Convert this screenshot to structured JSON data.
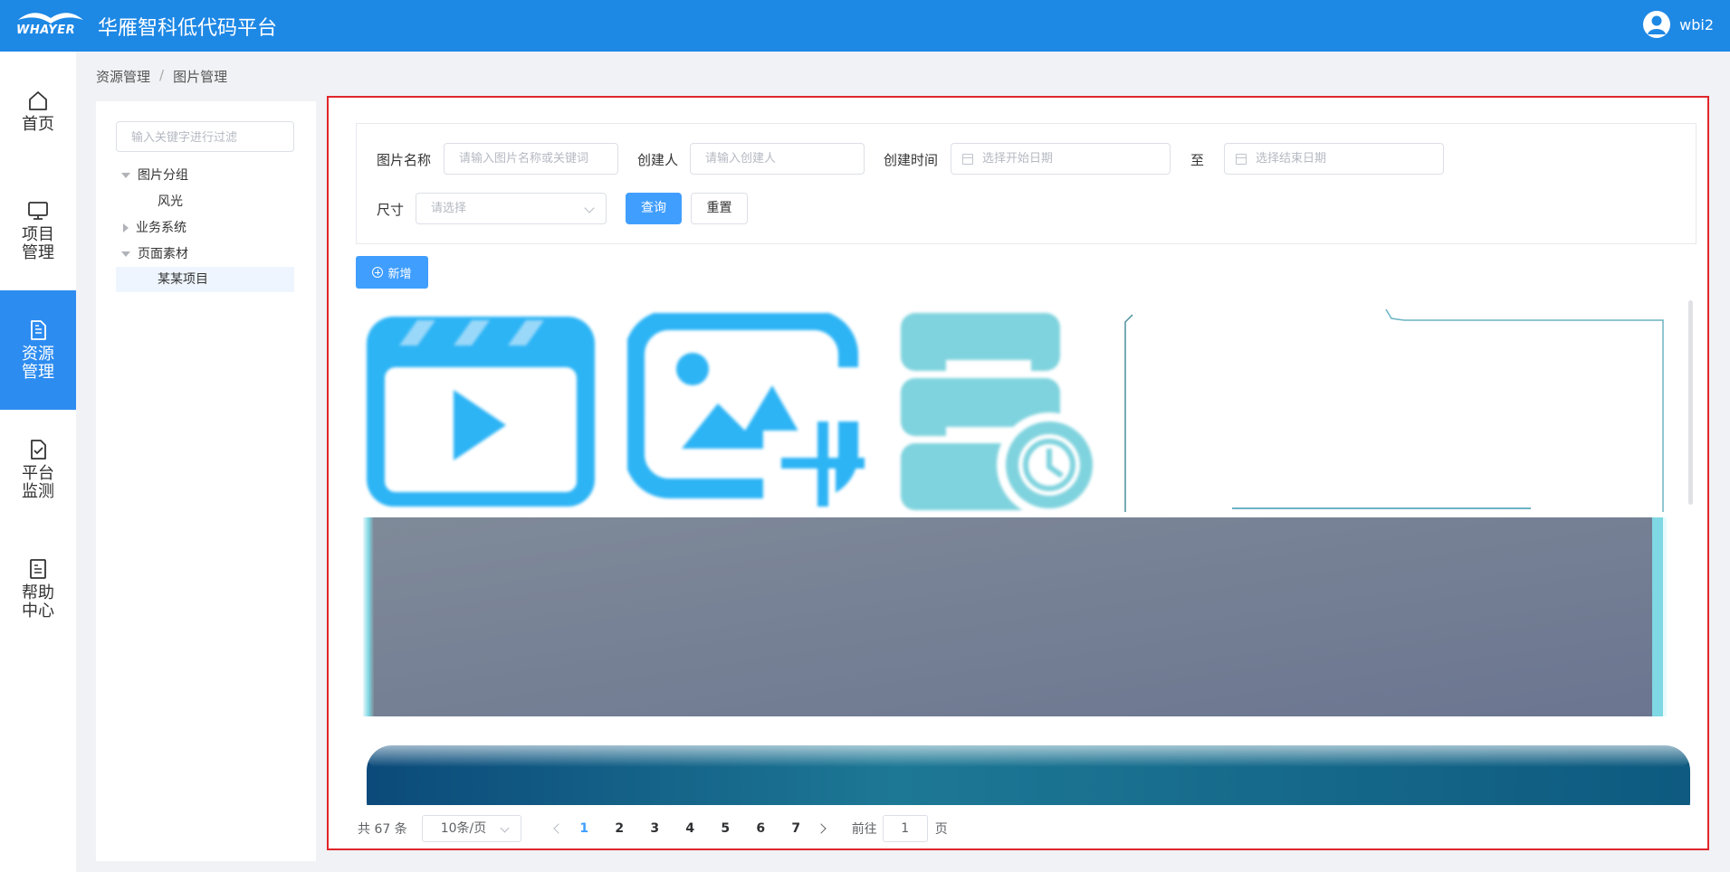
{
  "header": {
    "logo_text": "WHAYER",
    "title": "华雁智科低代码平台",
    "user_name": "wbi2"
  },
  "sidebar": {
    "items": [
      {
        "label": "首页",
        "icon": "home-icon",
        "active": false
      },
      {
        "label": "项目管理",
        "icon": "monitor-icon",
        "active": false
      },
      {
        "label": "资源管理",
        "icon": "document-icon",
        "active": true
      },
      {
        "label": "平台监测",
        "icon": "check-document-icon",
        "active": false
      },
      {
        "label": "帮助中心",
        "icon": "list-document-icon",
        "active": false
      }
    ]
  },
  "breadcrumb": {
    "items": [
      "资源管理",
      "图片管理"
    ],
    "separator": "/"
  },
  "tree": {
    "search_placeholder": "输入关键字进行过滤",
    "nodes": [
      {
        "label": "图片分组",
        "level": 1,
        "expanded": true
      },
      {
        "label": "风光",
        "level": 2
      },
      {
        "label": "业务系统",
        "level": 1,
        "expanded": false
      },
      {
        "label": "页面素材",
        "level": 1,
        "expanded": true
      },
      {
        "label": "某某项目",
        "level": 2,
        "selected": true
      }
    ]
  },
  "filters": {
    "name_label": "图片名称",
    "name_placeholder": "请输入图片名称或关键词",
    "creator_label": "创建人",
    "creator_placeholder": "请输入创建人",
    "time_label": "创建时间",
    "start_placeholder": "选择开始日期",
    "range_sep": "至",
    "end_placeholder": "选择结束日期",
    "size_label": "尺寸",
    "size_placeholder": "请选择",
    "query_label": "查询",
    "reset_label": "重置"
  },
  "toolbar": {
    "add_label": "新增"
  },
  "pagination": {
    "total_text": "共 67 条",
    "page_size": "10条/页",
    "pages": [
      "1",
      "2",
      "3",
      "4",
      "5",
      "6",
      "7"
    ],
    "current_page": "1",
    "goto_label": "前往",
    "goto_value": "1",
    "page_suffix": "页"
  },
  "colors": {
    "header_bg": "#1e88e5",
    "active_nav": "#2d8cf0",
    "primary": "#409eff",
    "highlight_border": "#e0262b"
  }
}
